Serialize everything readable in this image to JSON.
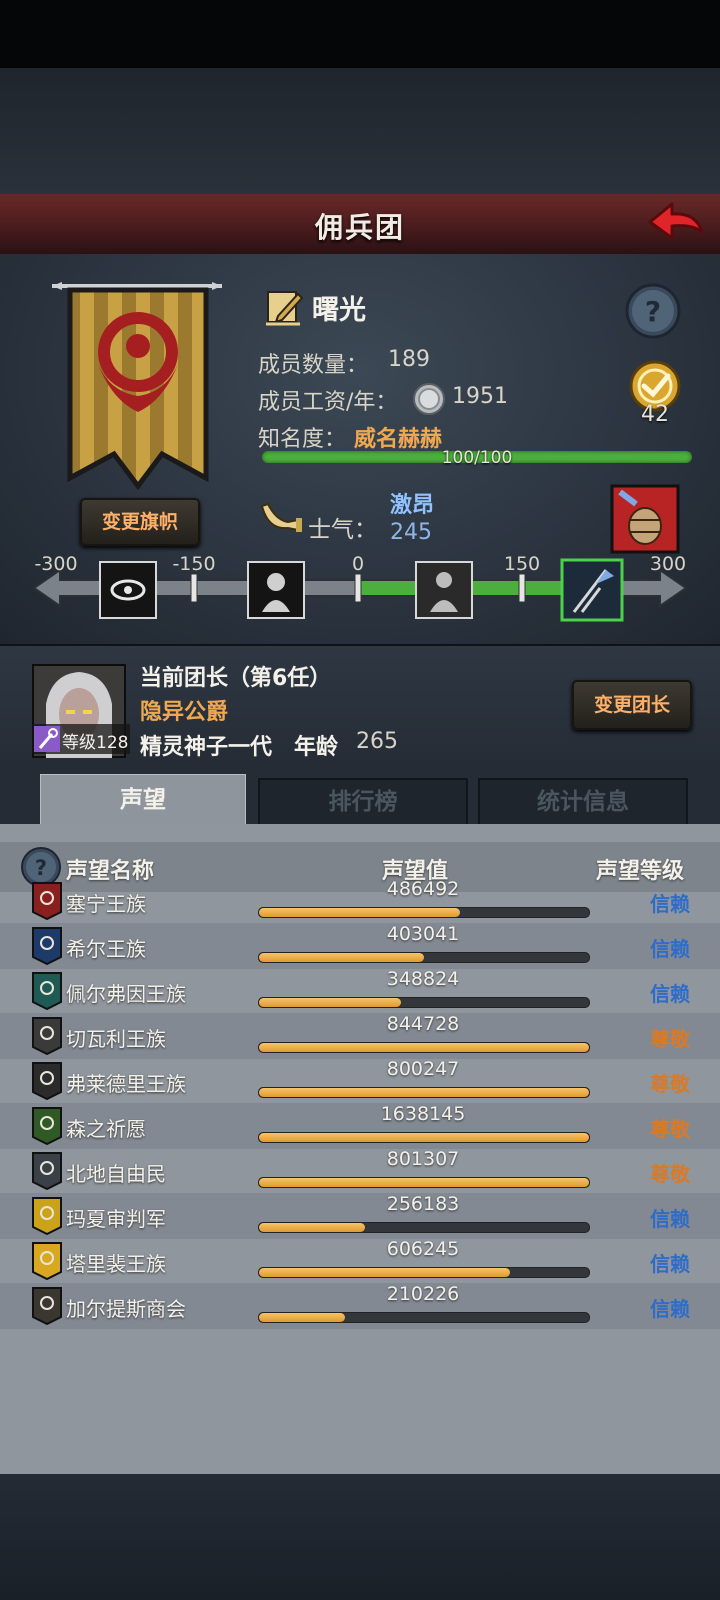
{
  "header": {
    "title": "佣兵团",
    "back_icon": "back-arrow-icon"
  },
  "company": {
    "name": "曙光",
    "members_label": "成员数量：",
    "members": "189",
    "salary_label": "成员工资/年：",
    "salary": "1951",
    "fame_label": "知名度：",
    "fame_rank": "威名赫赫",
    "fame_progress_text": "100/100",
    "fame_progress": 1.0,
    "badge_count": "42",
    "change_flag_label": "变更旗帜",
    "morale_label": "士气：",
    "morale_state": "激昂",
    "morale_value": "245"
  },
  "morale_scale": {
    "ticks": [
      "-300",
      "-150",
      "0",
      "150",
      "300"
    ],
    "min": -300,
    "max": 300,
    "value": 245,
    "icons": [
      "panic-eye-icon",
      "despair-icon",
      "calm-icon",
      "victory-banner-icon"
    ]
  },
  "leader": {
    "title": "当前团长（第6任）",
    "name": "隐异公爵",
    "level_label": "等级128",
    "race": "精灵神子一代",
    "age_label": "年龄",
    "age": "265",
    "change_label": "变更团长"
  },
  "tabs": [
    {
      "label": "声望",
      "active": true
    },
    {
      "label": "排行榜",
      "active": false
    },
    {
      "label": "统计信息",
      "active": false
    }
  ],
  "reputation": {
    "headers": [
      "声望名称",
      "声望值",
      "声望等级"
    ],
    "rows": [
      {
        "name": "塞宁王族",
        "value": "486492",
        "progress": 0.61,
        "level": "信赖",
        "tier": "trust",
        "crest_color": "#8a1f1f"
      },
      {
        "name": "希尔王族",
        "value": "403041",
        "progress": 0.5,
        "level": "信赖",
        "tier": "trust",
        "crest_color": "#1e3a6a"
      },
      {
        "name": "佩尔弗因王族",
        "value": "348824",
        "progress": 0.43,
        "level": "信赖",
        "tier": "trust",
        "crest_color": "#1f5a55"
      },
      {
        "name": "切瓦利王族",
        "value": "844728",
        "progress": 1.0,
        "level": "尊敬",
        "tier": "respect",
        "crest_color": "#3a3a3a"
      },
      {
        "name": "弗莱德里王族",
        "value": "800247",
        "progress": 1.0,
        "level": "尊敬",
        "tier": "respect",
        "crest_color": "#2b2b2b"
      },
      {
        "name": "森之祈愿",
        "value": "1638145",
        "progress": 1.0,
        "level": "尊敬",
        "tier": "respect",
        "crest_color": "#2f5a25"
      },
      {
        "name": "北地自由民",
        "value": "801307",
        "progress": 1.0,
        "level": "尊敬",
        "tier": "respect",
        "crest_color": "#3a4048"
      },
      {
        "name": "玛夏审判军",
        "value": "256183",
        "progress": 0.32,
        "level": "信赖",
        "tier": "trust",
        "crest_color": "#caa31a"
      },
      {
        "name": "塔里裴王族",
        "value": "606245",
        "progress": 0.76,
        "level": "信赖",
        "tier": "trust",
        "crest_color": "#d8a820"
      },
      {
        "name": "加尔提斯商会",
        "value": "210226",
        "progress": 0.26,
        "level": "信赖",
        "tier": "trust",
        "crest_color": "#3a3630"
      }
    ]
  }
}
